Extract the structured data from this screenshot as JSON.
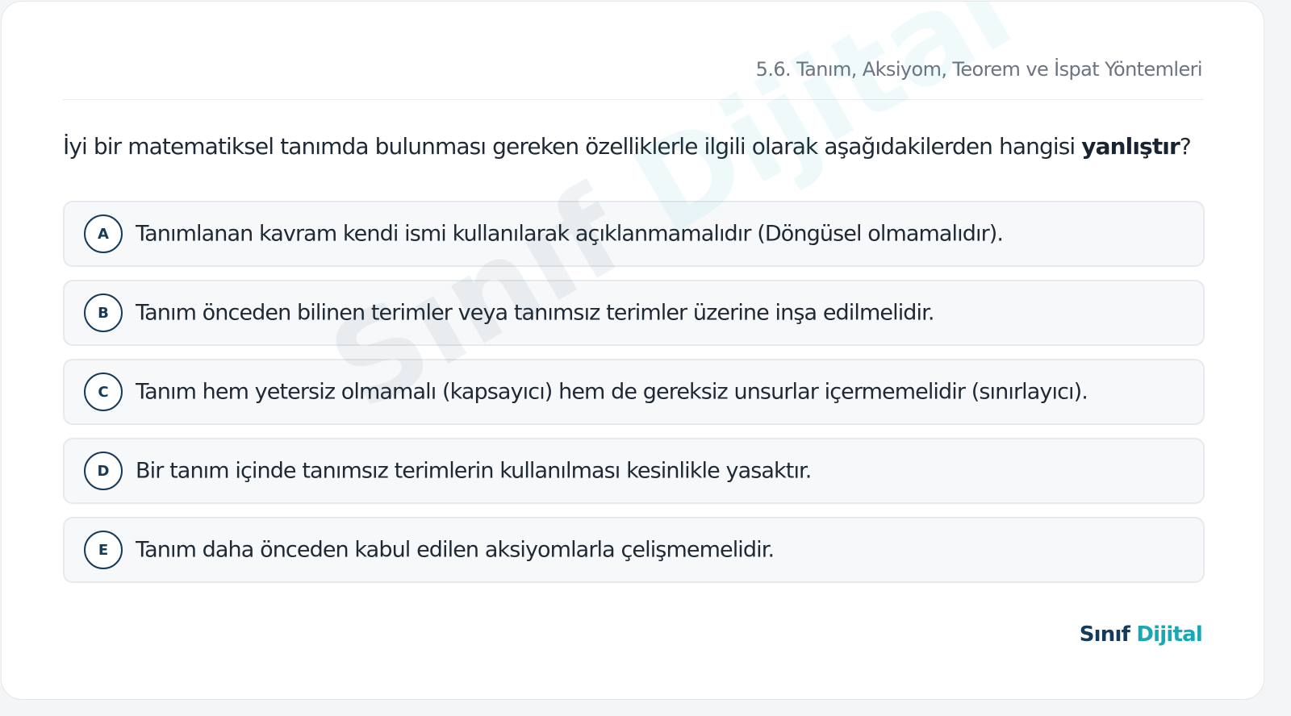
{
  "topic": "5.6. Tanım, Aksiyom, Teorem ve İspat Yöntemleri",
  "question": {
    "text_before": "İyi bir matematiksel tanımda bulunması gereken özelliklerle ilgili olarak aşağıdakilerden hangisi ",
    "emphasis": "yanlıştır",
    "text_after": "?"
  },
  "options": [
    {
      "letter": "A",
      "text": "Tanımlanan kavram kendi ismi kullanılarak açıklanmamalıdır (Döngüsel olmamalıdır)."
    },
    {
      "letter": "B",
      "text": "Tanım önceden bilinen terimler veya tanımsız terimler üzerine inşa edilmelidir."
    },
    {
      "letter": "C",
      "text": "Tanım hem yetersiz olmamalı (kapsayıcı) hem de gereksiz unsurlar içermemelidir (sınırlayıcı)."
    },
    {
      "letter": "D",
      "text": "Bir tanım içinde tanımsız terimlerin kullanılması kesinlikle yasaktır."
    },
    {
      "letter": "E",
      "text": "Tanım daha önceden kabul edilen aksiyomlarla çelişmemelidir."
    }
  ],
  "watermark": {
    "part1": "Sınıf",
    "part2": "Dijital"
  },
  "brand": {
    "part1": "Sınıf",
    "part2": "Dijital"
  },
  "colors": {
    "primary": "#163a59",
    "accent": "#16a9b4",
    "option_bg": "#f6f8fa",
    "option_border": "#e6e9ed"
  }
}
